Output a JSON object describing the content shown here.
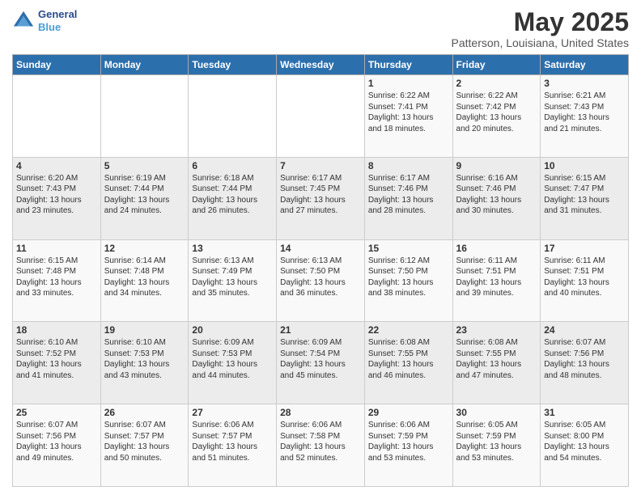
{
  "header": {
    "logo_line1": "General",
    "logo_line2": "Blue",
    "title": "May 2025",
    "subtitle": "Patterson, Louisiana, United States"
  },
  "weekdays": [
    "Sunday",
    "Monday",
    "Tuesday",
    "Wednesday",
    "Thursday",
    "Friday",
    "Saturday"
  ],
  "weeks": [
    [
      {
        "day": "",
        "content": ""
      },
      {
        "day": "",
        "content": ""
      },
      {
        "day": "",
        "content": ""
      },
      {
        "day": "",
        "content": ""
      },
      {
        "day": "1",
        "content": "Sunrise: 6:22 AM\nSunset: 7:41 PM\nDaylight: 13 hours\nand 18 minutes."
      },
      {
        "day": "2",
        "content": "Sunrise: 6:22 AM\nSunset: 7:42 PM\nDaylight: 13 hours\nand 20 minutes."
      },
      {
        "day": "3",
        "content": "Sunrise: 6:21 AM\nSunset: 7:43 PM\nDaylight: 13 hours\nand 21 minutes."
      }
    ],
    [
      {
        "day": "4",
        "content": "Sunrise: 6:20 AM\nSunset: 7:43 PM\nDaylight: 13 hours\nand 23 minutes."
      },
      {
        "day": "5",
        "content": "Sunrise: 6:19 AM\nSunset: 7:44 PM\nDaylight: 13 hours\nand 24 minutes."
      },
      {
        "day": "6",
        "content": "Sunrise: 6:18 AM\nSunset: 7:44 PM\nDaylight: 13 hours\nand 26 minutes."
      },
      {
        "day": "7",
        "content": "Sunrise: 6:17 AM\nSunset: 7:45 PM\nDaylight: 13 hours\nand 27 minutes."
      },
      {
        "day": "8",
        "content": "Sunrise: 6:17 AM\nSunset: 7:46 PM\nDaylight: 13 hours\nand 28 minutes."
      },
      {
        "day": "9",
        "content": "Sunrise: 6:16 AM\nSunset: 7:46 PM\nDaylight: 13 hours\nand 30 minutes."
      },
      {
        "day": "10",
        "content": "Sunrise: 6:15 AM\nSunset: 7:47 PM\nDaylight: 13 hours\nand 31 minutes."
      }
    ],
    [
      {
        "day": "11",
        "content": "Sunrise: 6:15 AM\nSunset: 7:48 PM\nDaylight: 13 hours\nand 33 minutes."
      },
      {
        "day": "12",
        "content": "Sunrise: 6:14 AM\nSunset: 7:48 PM\nDaylight: 13 hours\nand 34 minutes."
      },
      {
        "day": "13",
        "content": "Sunrise: 6:13 AM\nSunset: 7:49 PM\nDaylight: 13 hours\nand 35 minutes."
      },
      {
        "day": "14",
        "content": "Sunrise: 6:13 AM\nSunset: 7:50 PM\nDaylight: 13 hours\nand 36 minutes."
      },
      {
        "day": "15",
        "content": "Sunrise: 6:12 AM\nSunset: 7:50 PM\nDaylight: 13 hours\nand 38 minutes."
      },
      {
        "day": "16",
        "content": "Sunrise: 6:11 AM\nSunset: 7:51 PM\nDaylight: 13 hours\nand 39 minutes."
      },
      {
        "day": "17",
        "content": "Sunrise: 6:11 AM\nSunset: 7:51 PM\nDaylight: 13 hours\nand 40 minutes."
      }
    ],
    [
      {
        "day": "18",
        "content": "Sunrise: 6:10 AM\nSunset: 7:52 PM\nDaylight: 13 hours\nand 41 minutes."
      },
      {
        "day": "19",
        "content": "Sunrise: 6:10 AM\nSunset: 7:53 PM\nDaylight: 13 hours\nand 43 minutes."
      },
      {
        "day": "20",
        "content": "Sunrise: 6:09 AM\nSunset: 7:53 PM\nDaylight: 13 hours\nand 44 minutes."
      },
      {
        "day": "21",
        "content": "Sunrise: 6:09 AM\nSunset: 7:54 PM\nDaylight: 13 hours\nand 45 minutes."
      },
      {
        "day": "22",
        "content": "Sunrise: 6:08 AM\nSunset: 7:55 PM\nDaylight: 13 hours\nand 46 minutes."
      },
      {
        "day": "23",
        "content": "Sunrise: 6:08 AM\nSunset: 7:55 PM\nDaylight: 13 hours\nand 47 minutes."
      },
      {
        "day": "24",
        "content": "Sunrise: 6:07 AM\nSunset: 7:56 PM\nDaylight: 13 hours\nand 48 minutes."
      }
    ],
    [
      {
        "day": "25",
        "content": "Sunrise: 6:07 AM\nSunset: 7:56 PM\nDaylight: 13 hours\nand 49 minutes."
      },
      {
        "day": "26",
        "content": "Sunrise: 6:07 AM\nSunset: 7:57 PM\nDaylight: 13 hours\nand 50 minutes."
      },
      {
        "day": "27",
        "content": "Sunrise: 6:06 AM\nSunset: 7:57 PM\nDaylight: 13 hours\nand 51 minutes."
      },
      {
        "day": "28",
        "content": "Sunrise: 6:06 AM\nSunset: 7:58 PM\nDaylight: 13 hours\nand 52 minutes."
      },
      {
        "day": "29",
        "content": "Sunrise: 6:06 AM\nSunset: 7:59 PM\nDaylight: 13 hours\nand 53 minutes."
      },
      {
        "day": "30",
        "content": "Sunrise: 6:05 AM\nSunset: 7:59 PM\nDaylight: 13 hours\nand 53 minutes."
      },
      {
        "day": "31",
        "content": "Sunrise: 6:05 AM\nSunset: 8:00 PM\nDaylight: 13 hours\nand 54 minutes."
      }
    ]
  ]
}
